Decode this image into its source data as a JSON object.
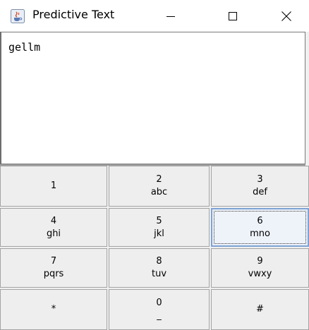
{
  "window": {
    "title": "Predictive Text",
    "controls": {
      "minimize": "—",
      "maximize": "☐",
      "close": "✕"
    }
  },
  "editor": {
    "text": "gellm"
  },
  "keypad": {
    "keys": [
      {
        "num": "1",
        "letters": ""
      },
      {
        "num": "2",
        "letters": "abc"
      },
      {
        "num": "3",
        "letters": "def"
      },
      {
        "num": "4",
        "letters": "ghi"
      },
      {
        "num": "5",
        "letters": "jkl"
      },
      {
        "num": "6",
        "letters": "mno"
      },
      {
        "num": "7",
        "letters": "pqrs"
      },
      {
        "num": "8",
        "letters": "tuv"
      },
      {
        "num": "9",
        "letters": "vwxy"
      },
      {
        "num": "*",
        "letters": ""
      },
      {
        "num": "0",
        "letters": "_"
      },
      {
        "num": "#",
        "letters": ""
      }
    ],
    "focused_key": "6"
  },
  "icons": {
    "app": "java-coffee-cup-icon"
  }
}
